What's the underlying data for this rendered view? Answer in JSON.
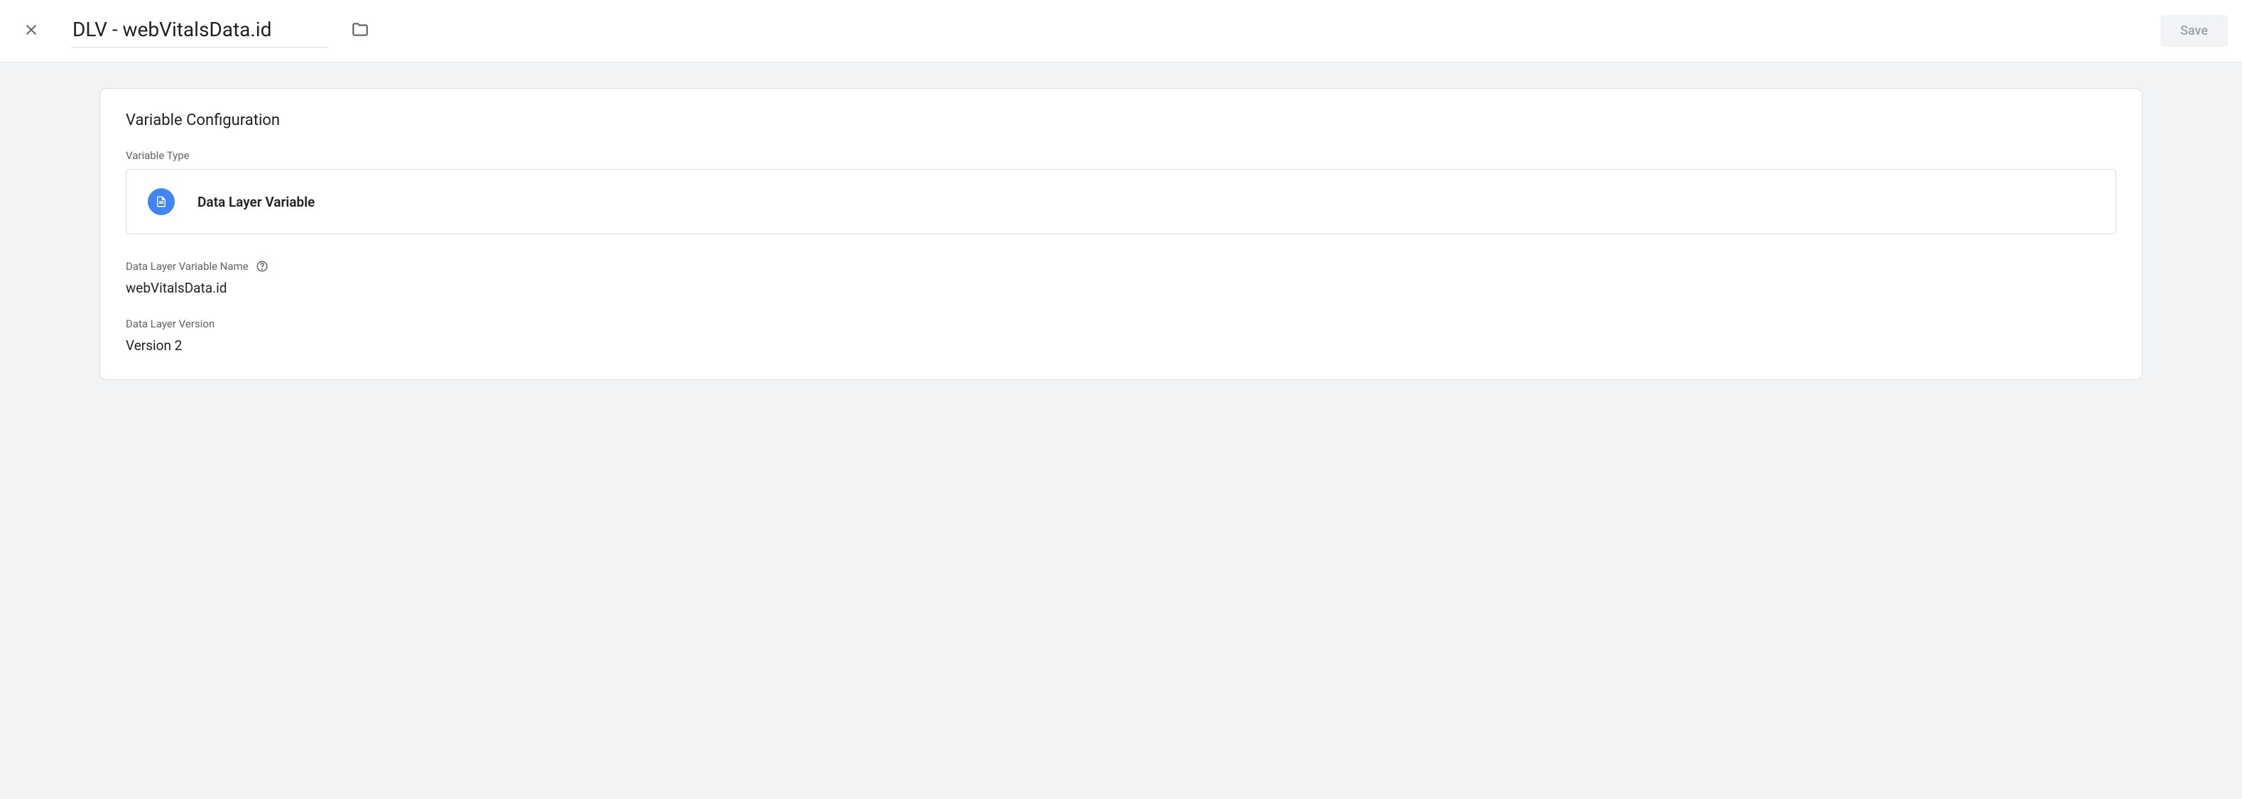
{
  "header": {
    "title": "DLV - webVitalsData.id",
    "save_label": "Save"
  },
  "card": {
    "title": "Variable Configuration",
    "variable_type_label": "Variable Type",
    "variable_type_name": "Data Layer Variable",
    "dlv_name_label": "Data Layer Variable Name",
    "dlv_name_value": "webVitalsData.id",
    "dlv_version_label": "Data Layer Version",
    "dlv_version_value": "Version 2"
  }
}
